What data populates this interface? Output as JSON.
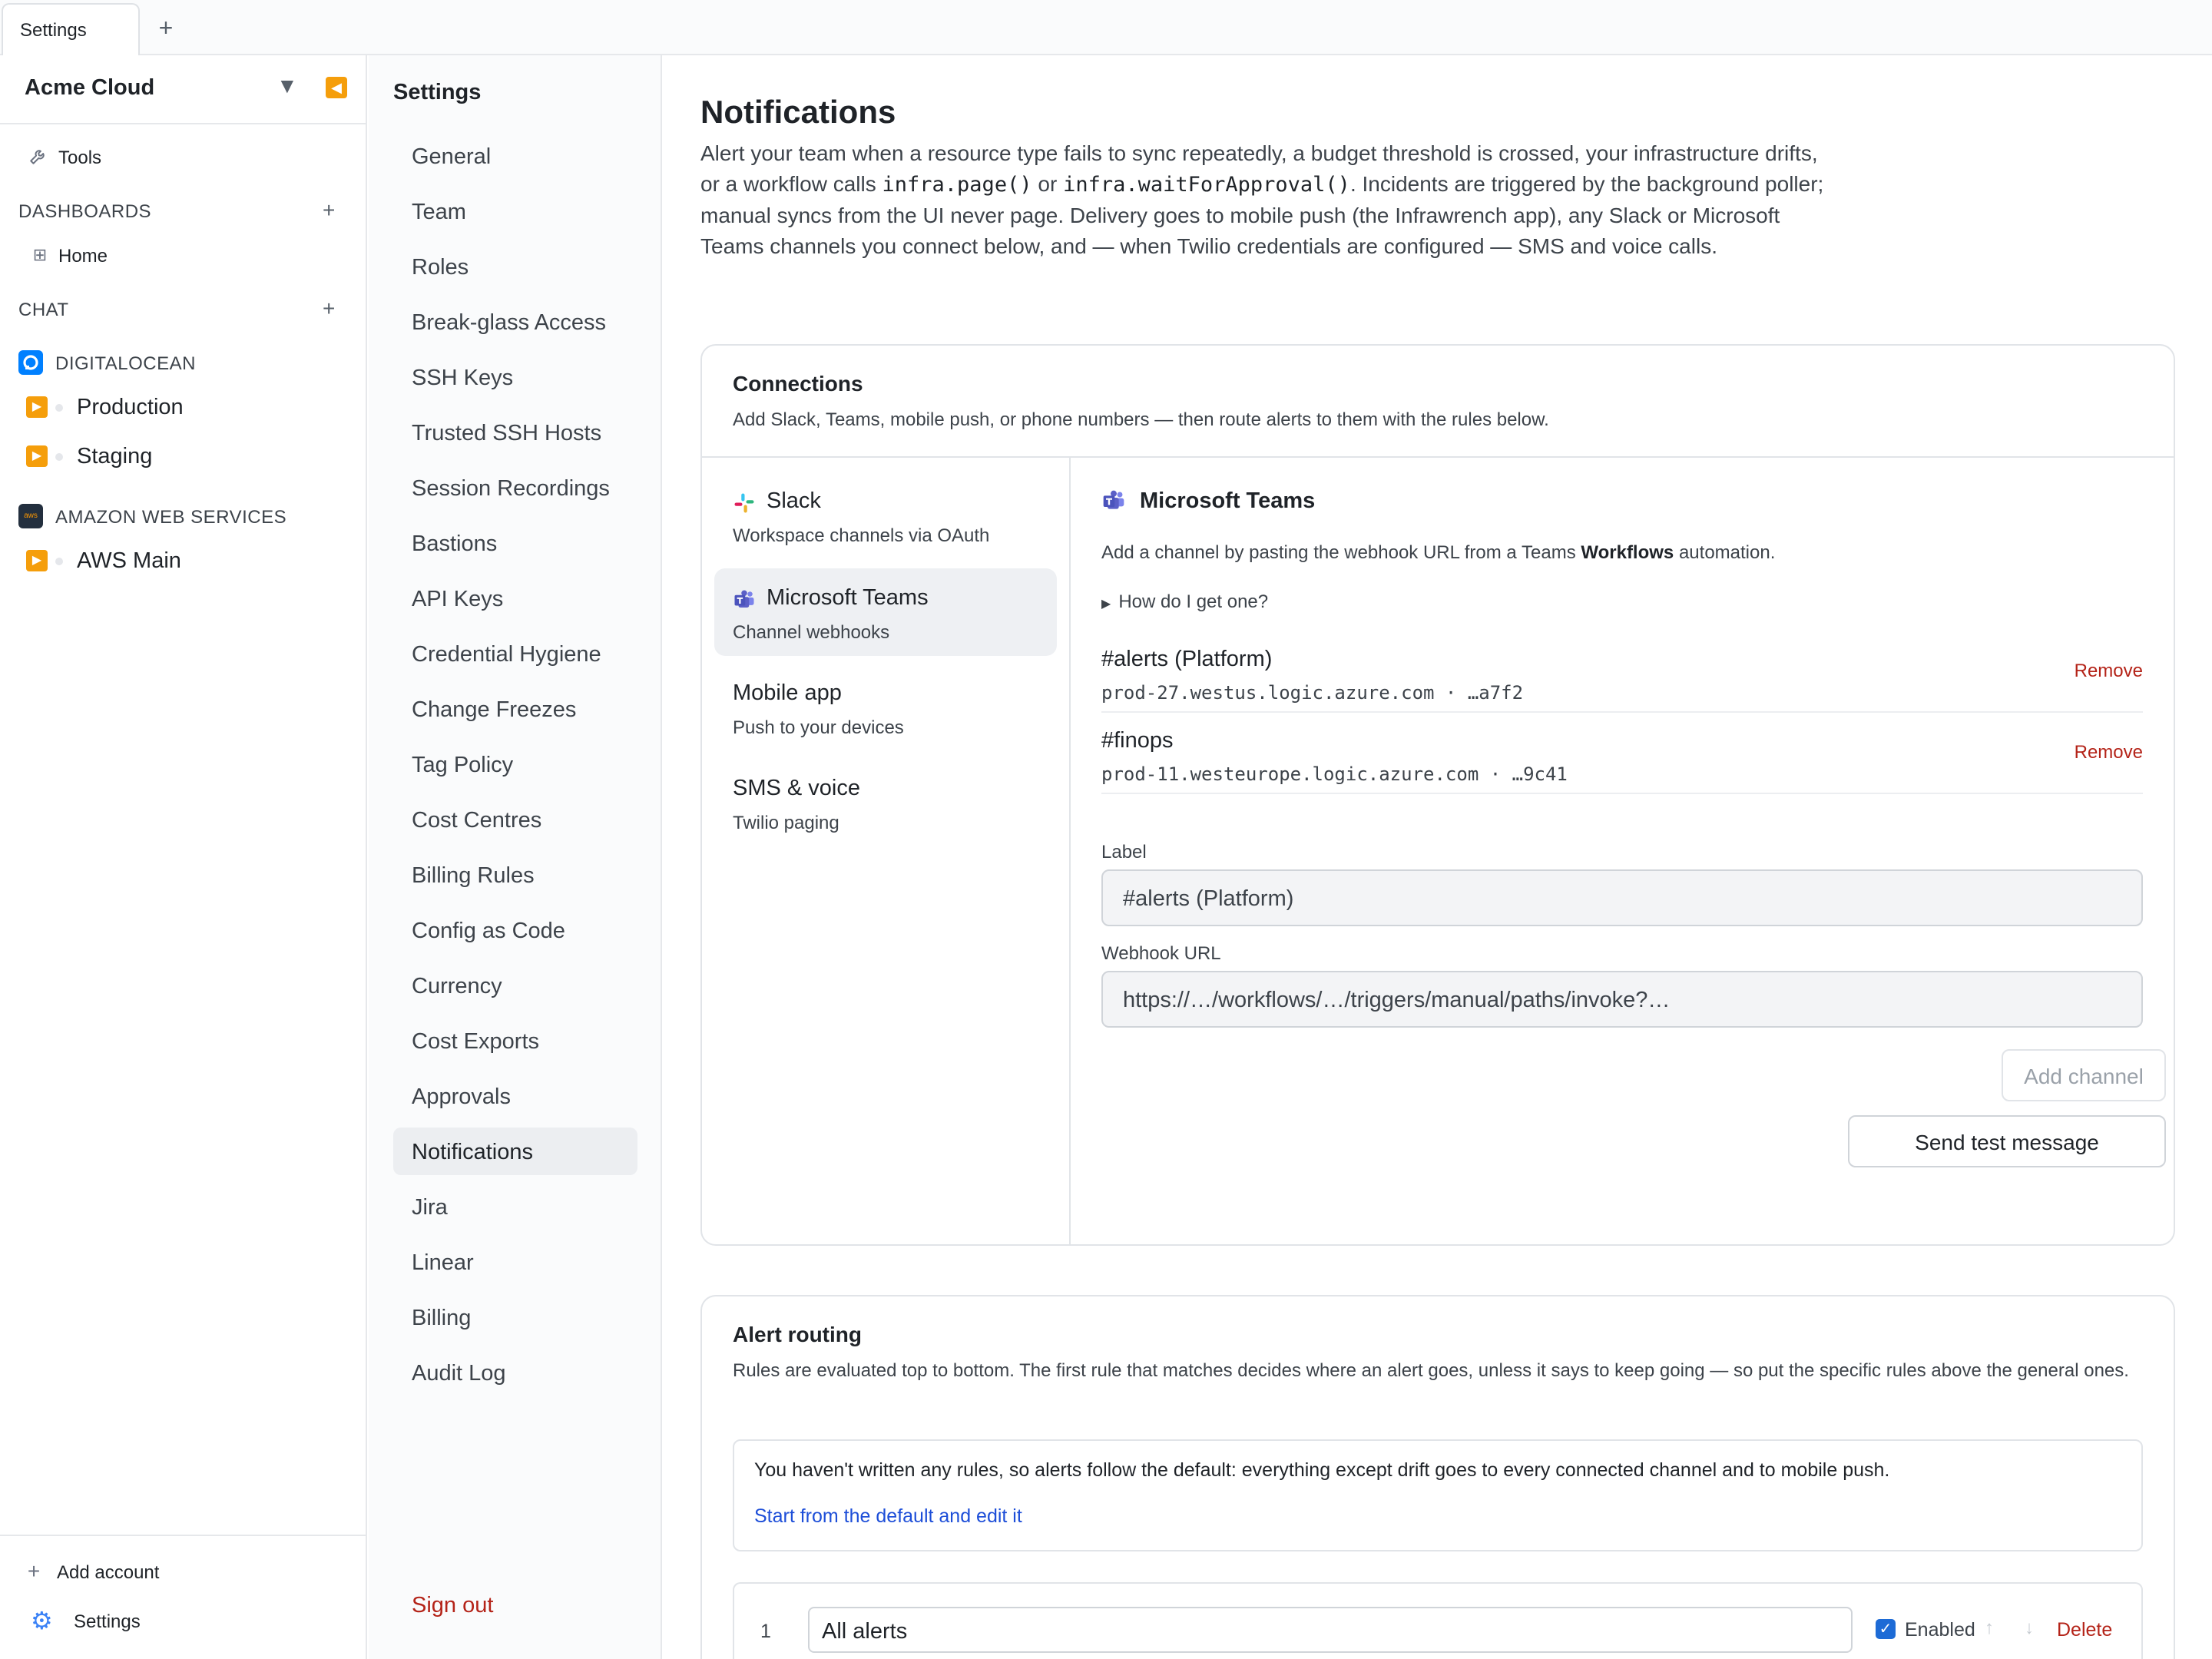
{
  "tabbar": {
    "active_tab": "Settings",
    "add_label": "+"
  },
  "sidebar": {
    "brand": "Acme Cloud",
    "tools_label": "Tools",
    "dashboards_label": "DASHBOARDS",
    "home_label": "Home",
    "chat_label": "CHAT",
    "plus": "+",
    "providers": [
      {
        "label": "DIGITALOCEAN",
        "accounts": [
          "Production",
          "Staging"
        ]
      },
      {
        "label": "AMAZON WEB SERVICES",
        "logo_text": "aws",
        "accounts": [
          "AWS Main"
        ]
      }
    ],
    "add_account_label": "Add account",
    "settings_label": "Settings"
  },
  "settings_nav": {
    "title": "Settings",
    "items": [
      "General",
      "Team",
      "Roles",
      "Break-glass Access",
      "SSH Keys",
      "Trusted SSH Hosts",
      "Session Recordings",
      "Bastions",
      "API Keys",
      "Credential Hygiene",
      "Change Freezes",
      "Tag Policy",
      "Cost Centres",
      "Billing Rules",
      "Config as Code",
      "Currency",
      "Cost Exports",
      "Approvals",
      "Notifications",
      "Jira",
      "Linear",
      "Billing",
      "Audit Log"
    ],
    "active_item": "Notifications",
    "sign_out_label": "Sign out"
  },
  "main": {
    "title": "Notifications",
    "intro": {
      "part1": "Alert your team when a resource type fails to sync repeatedly, a budget threshold is crossed, your infrastructure drifts, or a workflow calls ",
      "code1": "infra.page()",
      "part2": " or ",
      "code2": "infra.waitForApproval()",
      "part3": ". Incidents are triggered by the background poller; manual syncs from the UI never page. Delivery goes to mobile push (the Infrawrench app), any Slack or Microsoft Teams channels you connect below, and — when Twilio credentials are configured — SMS and voice calls."
    },
    "connections": {
      "title": "Connections",
      "subtitle": "Add Slack, Teams, mobile push, or phone numbers — then route alerts to them with the rules below.",
      "channels": [
        {
          "name": "Slack",
          "desc": "Workspace channels via OAuth"
        },
        {
          "name": "Microsoft Teams",
          "desc": "Channel webhooks"
        },
        {
          "name": "Mobile app",
          "desc": "Push to your devices"
        },
        {
          "name": "SMS & voice",
          "desc": "Twilio paging"
        }
      ],
      "active_channel": "Microsoft Teams",
      "panel": {
        "title": "Microsoft Teams",
        "desc_before": "Add a channel by pasting the webhook URL from a Teams ",
        "desc_bold": "Workflows",
        "desc_after": " automation.",
        "howto": "How do I get one?",
        "connected": [
          {
            "name": "#alerts (Platform)",
            "host": "prod-27.westus.logic.azure.com · …a7f2",
            "remove": "Remove"
          },
          {
            "name": "#finops",
            "host": "prod-11.westeurope.logic.azure.com · …9c41",
            "remove": "Remove"
          }
        ],
        "label_field": {
          "label": "Label",
          "placeholder": "#alerts (Platform)"
        },
        "url_field": {
          "label": "Webhook URL",
          "placeholder": "https://…/workflows/…/triggers/manual/paths/invoke?…"
        },
        "add_button": "Add channel",
        "test_button": "Send test message"
      }
    },
    "routing": {
      "title": "Alert routing",
      "subtitle": "Rules are evaluated top to bottom. The first rule that matches decides where an alert goes, unless it says to keep going — so put the specific rules above the general ones.",
      "default_text": "You haven't written any rules, so alerts follow the default: everything except drift goes to every connected channel and to mobile push.",
      "default_link": "Start from the default and edit it",
      "rule": {
        "number": "1",
        "name": "All alerts",
        "enabled_label": "Enabled",
        "delete_label": "Delete"
      }
    }
  },
  "colors": {
    "accent_orange": "#f59e0b",
    "danger_red": "#b42318",
    "link_blue": "#1d4ed8",
    "teams_purple": "#5b5fc7",
    "digitalocean_blue": "#0080ff"
  },
  "icons": [
    "tools-icon",
    "home-grid-icon",
    "digitalocean-logo-icon",
    "aws-logo-icon",
    "play-icon",
    "slack-icon",
    "teams-icon",
    "plus-icon",
    "gear-icon",
    "caret-down-icon",
    "collapse-icon"
  ]
}
